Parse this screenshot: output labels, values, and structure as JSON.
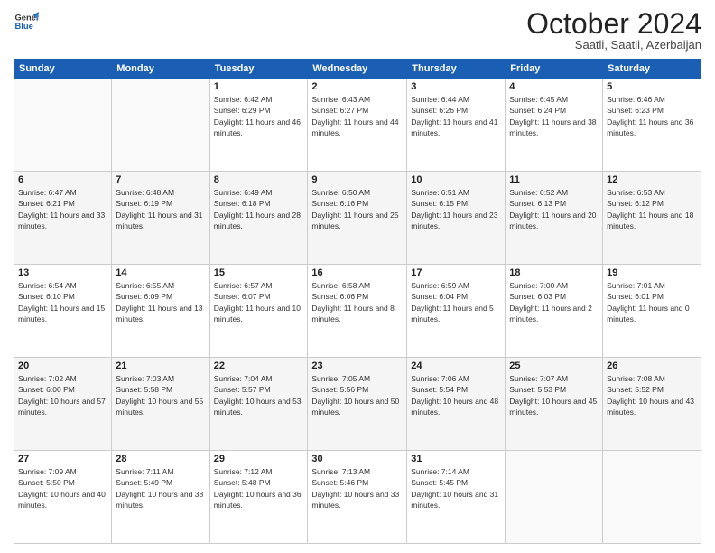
{
  "logo": {
    "line1": "General",
    "line2": "Blue"
  },
  "header": {
    "month": "October 2024",
    "location": "Saatli, Saatli, Azerbaijan"
  },
  "weekdays": [
    "Sunday",
    "Monday",
    "Tuesday",
    "Wednesday",
    "Thursday",
    "Friday",
    "Saturday"
  ],
  "weeks": [
    [
      {
        "day": "",
        "info": ""
      },
      {
        "day": "",
        "info": ""
      },
      {
        "day": "1",
        "info": "Sunrise: 6:42 AM\nSunset: 6:29 PM\nDaylight: 11 hours and 46 minutes."
      },
      {
        "day": "2",
        "info": "Sunrise: 6:43 AM\nSunset: 6:27 PM\nDaylight: 11 hours and 44 minutes."
      },
      {
        "day": "3",
        "info": "Sunrise: 6:44 AM\nSunset: 6:26 PM\nDaylight: 11 hours and 41 minutes."
      },
      {
        "day": "4",
        "info": "Sunrise: 6:45 AM\nSunset: 6:24 PM\nDaylight: 11 hours and 38 minutes."
      },
      {
        "day": "5",
        "info": "Sunrise: 6:46 AM\nSunset: 6:23 PM\nDaylight: 11 hours and 36 minutes."
      }
    ],
    [
      {
        "day": "6",
        "info": "Sunrise: 6:47 AM\nSunset: 6:21 PM\nDaylight: 11 hours and 33 minutes."
      },
      {
        "day": "7",
        "info": "Sunrise: 6:48 AM\nSunset: 6:19 PM\nDaylight: 11 hours and 31 minutes."
      },
      {
        "day": "8",
        "info": "Sunrise: 6:49 AM\nSunset: 6:18 PM\nDaylight: 11 hours and 28 minutes."
      },
      {
        "day": "9",
        "info": "Sunrise: 6:50 AM\nSunset: 6:16 PM\nDaylight: 11 hours and 25 minutes."
      },
      {
        "day": "10",
        "info": "Sunrise: 6:51 AM\nSunset: 6:15 PM\nDaylight: 11 hours and 23 minutes."
      },
      {
        "day": "11",
        "info": "Sunrise: 6:52 AM\nSunset: 6:13 PM\nDaylight: 11 hours and 20 minutes."
      },
      {
        "day": "12",
        "info": "Sunrise: 6:53 AM\nSunset: 6:12 PM\nDaylight: 11 hours and 18 minutes."
      }
    ],
    [
      {
        "day": "13",
        "info": "Sunrise: 6:54 AM\nSunset: 6:10 PM\nDaylight: 11 hours and 15 minutes."
      },
      {
        "day": "14",
        "info": "Sunrise: 6:55 AM\nSunset: 6:09 PM\nDaylight: 11 hours and 13 minutes."
      },
      {
        "day": "15",
        "info": "Sunrise: 6:57 AM\nSunset: 6:07 PM\nDaylight: 11 hours and 10 minutes."
      },
      {
        "day": "16",
        "info": "Sunrise: 6:58 AM\nSunset: 6:06 PM\nDaylight: 11 hours and 8 minutes."
      },
      {
        "day": "17",
        "info": "Sunrise: 6:59 AM\nSunset: 6:04 PM\nDaylight: 11 hours and 5 minutes."
      },
      {
        "day": "18",
        "info": "Sunrise: 7:00 AM\nSunset: 6:03 PM\nDaylight: 11 hours and 2 minutes."
      },
      {
        "day": "19",
        "info": "Sunrise: 7:01 AM\nSunset: 6:01 PM\nDaylight: 11 hours and 0 minutes."
      }
    ],
    [
      {
        "day": "20",
        "info": "Sunrise: 7:02 AM\nSunset: 6:00 PM\nDaylight: 10 hours and 57 minutes."
      },
      {
        "day": "21",
        "info": "Sunrise: 7:03 AM\nSunset: 5:58 PM\nDaylight: 10 hours and 55 minutes."
      },
      {
        "day": "22",
        "info": "Sunrise: 7:04 AM\nSunset: 5:57 PM\nDaylight: 10 hours and 53 minutes."
      },
      {
        "day": "23",
        "info": "Sunrise: 7:05 AM\nSunset: 5:56 PM\nDaylight: 10 hours and 50 minutes."
      },
      {
        "day": "24",
        "info": "Sunrise: 7:06 AM\nSunset: 5:54 PM\nDaylight: 10 hours and 48 minutes."
      },
      {
        "day": "25",
        "info": "Sunrise: 7:07 AM\nSunset: 5:53 PM\nDaylight: 10 hours and 45 minutes."
      },
      {
        "day": "26",
        "info": "Sunrise: 7:08 AM\nSunset: 5:52 PM\nDaylight: 10 hours and 43 minutes."
      }
    ],
    [
      {
        "day": "27",
        "info": "Sunrise: 7:09 AM\nSunset: 5:50 PM\nDaylight: 10 hours and 40 minutes."
      },
      {
        "day": "28",
        "info": "Sunrise: 7:11 AM\nSunset: 5:49 PM\nDaylight: 10 hours and 38 minutes."
      },
      {
        "day": "29",
        "info": "Sunrise: 7:12 AM\nSunset: 5:48 PM\nDaylight: 10 hours and 36 minutes."
      },
      {
        "day": "30",
        "info": "Sunrise: 7:13 AM\nSunset: 5:46 PM\nDaylight: 10 hours and 33 minutes."
      },
      {
        "day": "31",
        "info": "Sunrise: 7:14 AM\nSunset: 5:45 PM\nDaylight: 10 hours and 31 minutes."
      },
      {
        "day": "",
        "info": ""
      },
      {
        "day": "",
        "info": ""
      }
    ]
  ]
}
